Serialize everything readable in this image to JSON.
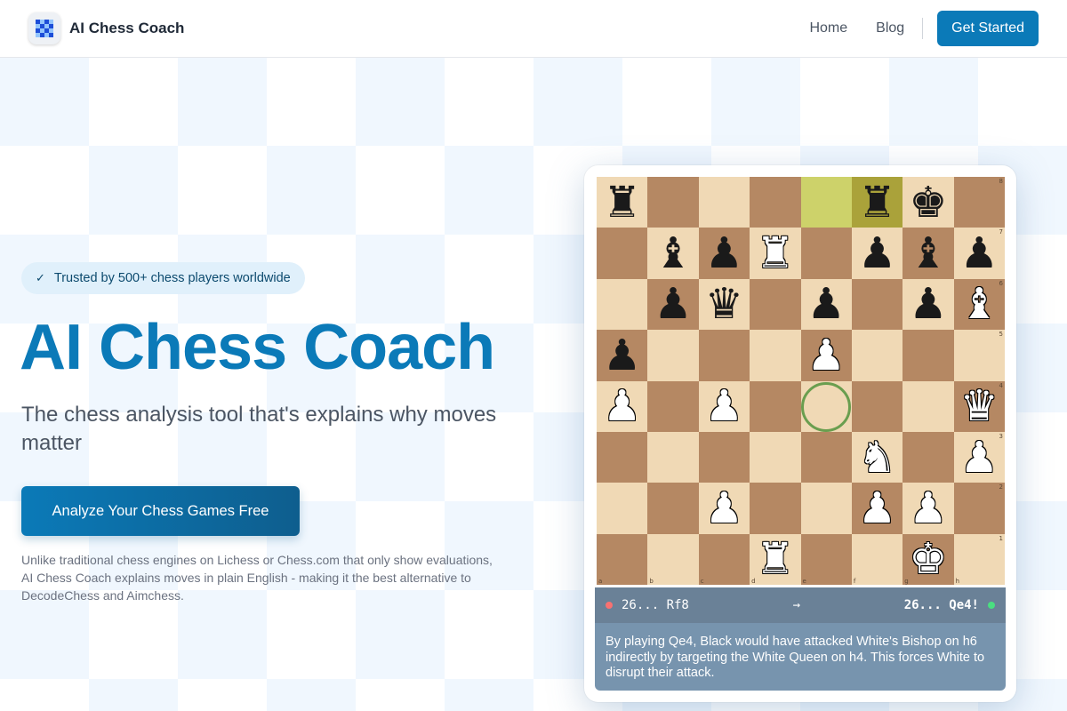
{
  "header": {
    "brand": "AI Chess Coach",
    "nav": [
      {
        "label": "Home"
      },
      {
        "label": "Blog"
      }
    ],
    "cta": "Get Started"
  },
  "hero": {
    "badge_check": "✓",
    "badge": "Trusted by 500+ chess players worldwide",
    "title": "AI Chess Coach",
    "subtitle": "The chess analysis tool that's explains why moves matter",
    "button": "Analyze Your Chess Games Free",
    "note": "Unlike traditional chess engines on Lichess or Chess.com that only show evaluations, AI Chess Coach explains moves in plain English - making it the best alternative to DecodeChess and Aimchess."
  },
  "board": {
    "ranks": [
      "r....rk.",
      ".bpR.pbp",
      ".pq.p.pB",
      "p...P...",
      "P.P....Q",
      ".....N.P",
      "..P..PP.",
      "...R..K."
    ],
    "highlight": [
      "e8",
      "f8"
    ],
    "target": "e4",
    "files": [
      "a",
      "b",
      "c",
      "d",
      "e",
      "f",
      "g",
      "h"
    ],
    "rank_labels": [
      "8",
      "7",
      "6",
      "5",
      "4",
      "3",
      "2",
      "1"
    ],
    "colors": {
      "light": "#f0d9b5",
      "dark": "#b58863",
      "accent": "#0b7ab8"
    }
  },
  "analysis": {
    "played": "26... Rf8",
    "arrow": "→",
    "best": "26... Qe4!",
    "explanation": "By playing Qe4, Black would have attacked White's Bishop on h6 indirectly by targeting the White Queen on h4. This forces White to disrupt their attack."
  }
}
